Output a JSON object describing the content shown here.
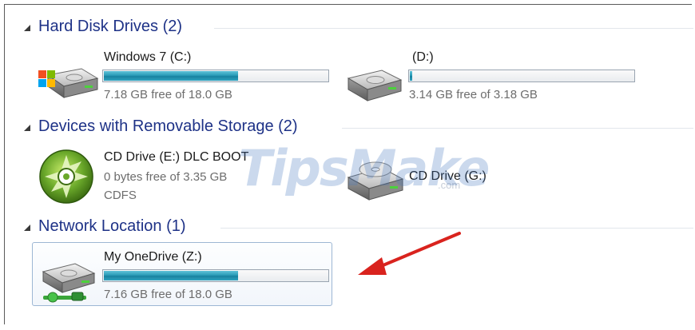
{
  "groups": [
    {
      "title": "Hard Disk Drives (2)"
    },
    {
      "title": "Devices with Removable Storage (2)"
    },
    {
      "title": "Network Location (1)"
    }
  ],
  "drives": {
    "c": {
      "name": "Windows 7 (C:)",
      "free": "7.18 GB free of 18.0 GB",
      "used_fraction": 0.6,
      "icon": "windows-hard-drive-icon"
    },
    "d": {
      "name": "(D:)",
      "free": "3.14 GB free of 3.18 GB",
      "used_fraction": 0.012,
      "icon": "hard-drive-icon"
    },
    "e": {
      "name": "CD Drive (E:) DLC BOOT",
      "free": "0 bytes free of 3.35 GB",
      "fs": "CDFS",
      "icon": "cd-disc-icon"
    },
    "g": {
      "name": "CD Drive (G:)",
      "icon": "cd-drive-icon"
    },
    "z": {
      "name": "My OneDrive (Z:)",
      "free": "7.16 GB free of 18.0 GB",
      "used_fraction": 0.6,
      "icon": "network-drive-icon"
    }
  },
  "watermark": {
    "main": "TipsMake",
    "sub": ".com"
  },
  "colors": {
    "group_title": "#1e3287",
    "bar_fill": "#2a9bb8",
    "selection_border": "#9db7d4",
    "arrow": "#d9231e"
  }
}
